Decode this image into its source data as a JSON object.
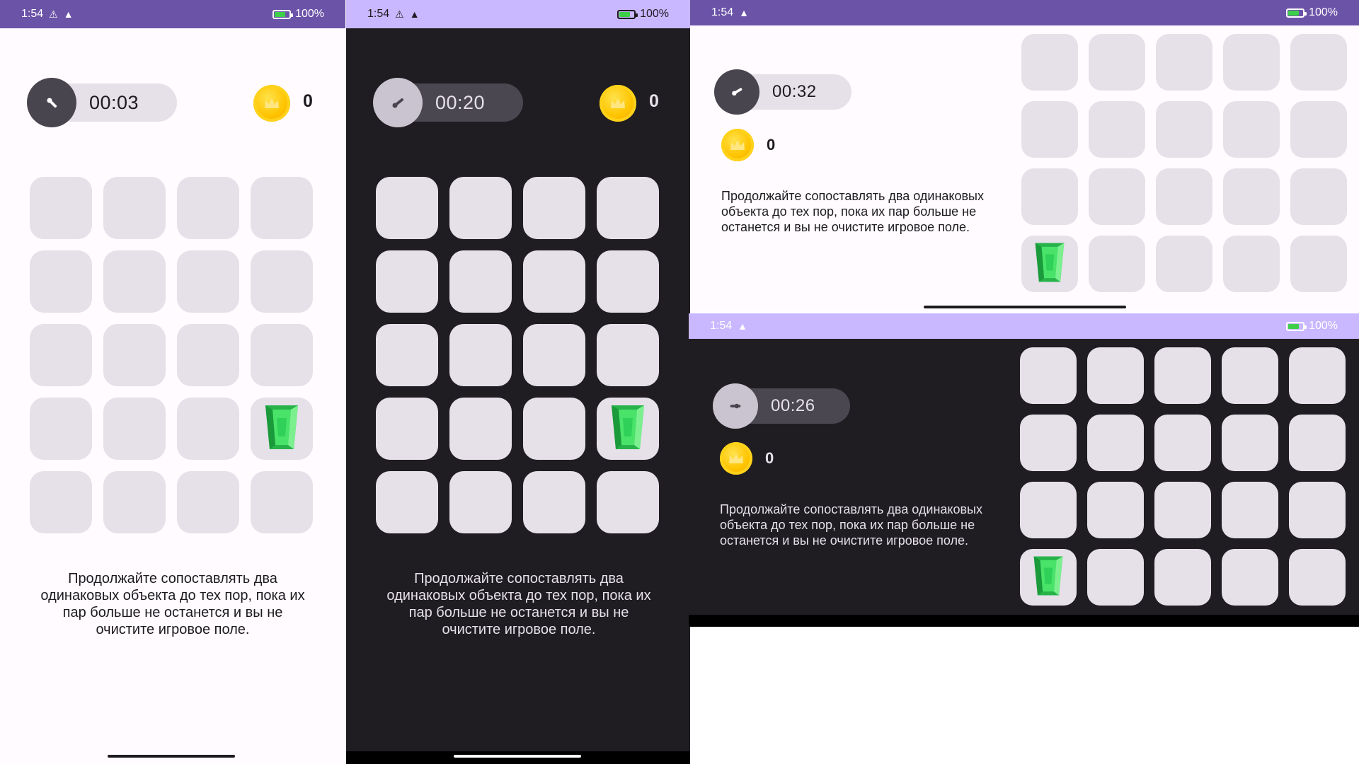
{
  "status": {
    "time": "1:54",
    "battery": "100%"
  },
  "screens": [
    {
      "name": "portrait-light",
      "timer": "00:03",
      "score": "0",
      "hint": "Продолжайте сопоставлять два одинаковых объекта до тех пор, пока их пар больше не останется и вы не очистите игровое поле."
    },
    {
      "name": "portrait-dark",
      "timer": "00:20",
      "score": "0",
      "hint": "Продолжайте сопоставлять два одинаковых объекта до тех пор, пока их пар больше не останется и вы не очистите игровое поле."
    },
    {
      "name": "landscape-light",
      "timer": "00:32",
      "score": "0",
      "hint": "Продолжайте сопоставлять два одинаковых объекта до тех пор, пока их пар больше не останется и вы не очистите игровое поле."
    },
    {
      "name": "landscape-dark",
      "timer": "00:26",
      "score": "0",
      "hint": "Продолжайте сопоставлять два одинаковых объекта до тех пор, пока их пар больше не останется и вы не очистите игровое поле."
    }
  ],
  "colors": {
    "statusbar_dark_purple": "#6b53a8",
    "statusbar_light_purple": "#c9b8ff",
    "tile": "#e6e0e9",
    "dark_bg": "#1f1d22",
    "gem_green": "#3ddc55",
    "coin_gold": "#ffc400"
  },
  "icons": {
    "timer_knob": "stopwatch-hand-icon",
    "coin": "crown-coin-icon",
    "revealed_tile": "emerald-gem-icon"
  }
}
